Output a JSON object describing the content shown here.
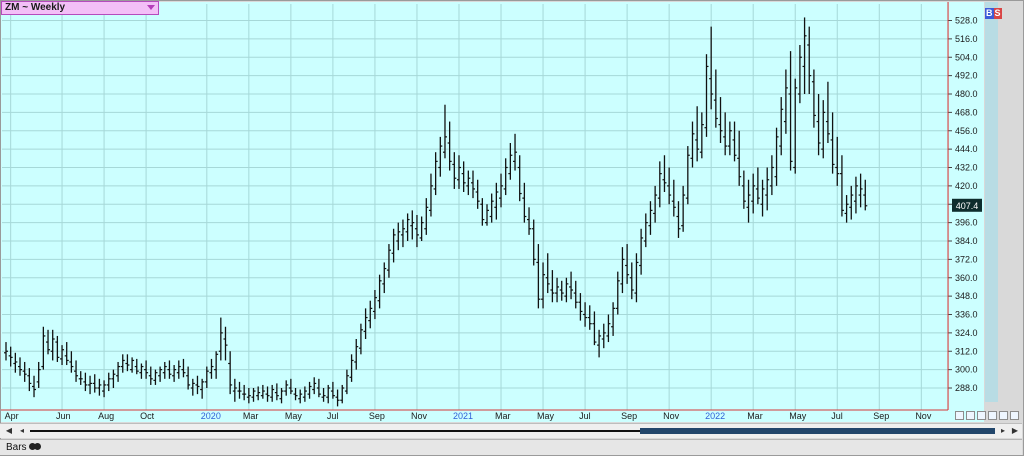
{
  "symbol": {
    "label": "ZM ~ Weekly",
    "dropdown_icon": "triangle-down-icon"
  },
  "rs_badges": [
    {
      "text": "B",
      "color": "#3d5bd9"
    },
    {
      "text": "S",
      "color": "#d94545"
    }
  ],
  "last_price": "407.4",
  "status": {
    "label": "Bars",
    "icon": "glasses-icon"
  },
  "colors": {
    "plot_bg": "#ccffff",
    "grid": "#a6d8d8",
    "bars": "#111111",
    "axis_line": "#d33a3a",
    "year_label": "#2f5fd8",
    "price_tag_bg": "#0e2d2d",
    "right_strip": "#b8dce4"
  },
  "chart_data": {
    "type": "ohlc_bar",
    "title": "ZM ~ Weekly",
    "ylim": [
      276,
      538
    ],
    "y_ticks": [
      288,
      300,
      312,
      324,
      336,
      348,
      360,
      372,
      384,
      396,
      408,
      420,
      432,
      444,
      456,
      468,
      480,
      492,
      504,
      516,
      528
    ],
    "x_ticks": [
      {
        "label": "Apr",
        "week": 1,
        "year": false
      },
      {
        "label": "Jun",
        "week": 12,
        "year": false
      },
      {
        "label": "Aug",
        "week": 21,
        "year": false
      },
      {
        "label": "Oct",
        "week": 30,
        "year": false
      },
      {
        "label": "2020",
        "week": 43,
        "year": true
      },
      {
        "label": "Mar",
        "week": 52,
        "year": false
      },
      {
        "label": "May",
        "week": 61,
        "year": false
      },
      {
        "label": "Jul",
        "week": 70,
        "year": false
      },
      {
        "label": "Sep",
        "week": 79,
        "year": false
      },
      {
        "label": "Nov",
        "week": 88,
        "year": false
      },
      {
        "label": "2021",
        "week": 97,
        "year": true
      },
      {
        "label": "Mar",
        "week": 106,
        "year": false
      },
      {
        "label": "May",
        "week": 115,
        "year": false
      },
      {
        "label": "Jul",
        "week": 124,
        "year": false
      },
      {
        "label": "Sep",
        "week": 133,
        "year": false
      },
      {
        "label": "Nov",
        "week": 142,
        "year": false
      },
      {
        "label": "2022",
        "week": 151,
        "year": true
      },
      {
        "label": "Mar",
        "week": 160,
        "year": false
      },
      {
        "label": "May",
        "week": 169,
        "year": false
      },
      {
        "label": "Jul",
        "week": 178,
        "year": false
      },
      {
        "label": "Sep",
        "week": 187,
        "year": false
      },
      {
        "label": "Nov",
        "week": 196,
        "year": false
      }
    ],
    "bars": [
      [
        311,
        318,
        306,
        312
      ],
      [
        309,
        315,
        302,
        308
      ],
      [
        304,
        311,
        298,
        305
      ],
      [
        302,
        308,
        296,
        300
      ],
      [
        299,
        305,
        292,
        297
      ],
      [
        296,
        301,
        286,
        291
      ],
      [
        289,
        296,
        282,
        287
      ],
      [
        292,
        305,
        288,
        300
      ],
      [
        302,
        328,
        300,
        322
      ],
      [
        318,
        326,
        310,
        313
      ],
      [
        312,
        326,
        306,
        320
      ],
      [
        318,
        322,
        305,
        308
      ],
      [
        307,
        316,
        303,
        313
      ],
      [
        309,
        318,
        303,
        306
      ],
      [
        305,
        312,
        298,
        302
      ],
      [
        299,
        306,
        292,
        296
      ],
      [
        294,
        299,
        290,
        294
      ],
      [
        292,
        298,
        286,
        290
      ],
      [
        290,
        296,
        284,
        291
      ],
      [
        291,
        297,
        285,
        288
      ],
      [
        288,
        294,
        283,
        290
      ],
      [
        286,
        293,
        282,
        290
      ],
      [
        290,
        298,
        286,
        294
      ],
      [
        294,
        300,
        288,
        297
      ],
      [
        296,
        305,
        292,
        302
      ],
      [
        302,
        310,
        298,
        306
      ],
      [
        304,
        310,
        299,
        303
      ],
      [
        300,
        308,
        298,
        306
      ],
      [
        302,
        307,
        297,
        299
      ],
      [
        298,
        304,
        294,
        302
      ],
      [
        300,
        306,
        294,
        298
      ],
      [
        296,
        302,
        290,
        294
      ],
      [
        293,
        300,
        290,
        298
      ],
      [
        296,
        302,
        292,
        300
      ],
      [
        298,
        305,
        294,
        302
      ],
      [
        300,
        306,
        294,
        297
      ],
      [
        296,
        303,
        292,
        300
      ],
      [
        298,
        306,
        294,
        302
      ],
      [
        300,
        307,
        295,
        298
      ],
      [
        296,
        302,
        287,
        290
      ],
      [
        288,
        294,
        283,
        291
      ],
      [
        290,
        296,
        284,
        289
      ],
      [
        287,
        294,
        281,
        292
      ],
      [
        292,
        302,
        288,
        299
      ],
      [
        298,
        307,
        294,
        302
      ],
      [
        300,
        312,
        294,
        310
      ],
      [
        312,
        334,
        306,
        324
      ],
      [
        320,
        328,
        306,
        316
      ],
      [
        304,
        312,
        284,
        290
      ],
      [
        286,
        294,
        279,
        288
      ],
      [
        286,
        292,
        281,
        286
      ],
      [
        284,
        290,
        280,
        284
      ],
      [
        282,
        288,
        278,
        283
      ],
      [
        282,
        288,
        279,
        286
      ],
      [
        283,
        289,
        280,
        285
      ],
      [
        283,
        290,
        281,
        286
      ],
      [
        284,
        289,
        279,
        283
      ],
      [
        282,
        290,
        279,
        287
      ],
      [
        285,
        291,
        280,
        283
      ],
      [
        281,
        288,
        278,
        286
      ],
      [
        286,
        293,
        283,
        290
      ],
      [
        288,
        294,
        284,
        286
      ],
      [
        284,
        288,
        280,
        283
      ],
      [
        281,
        287,
        278,
        284
      ],
      [
        282,
        289,
        279,
        286
      ],
      [
        284,
        292,
        281,
        289
      ],
      [
        287,
        295,
        284,
        291
      ],
      [
        288,
        294,
        282,
        284
      ],
      [
        282,
        288,
        279,
        283
      ],
      [
        282,
        290,
        278,
        288
      ],
      [
        286,
        292,
        281,
        283
      ],
      [
        282,
        287,
        276,
        280
      ],
      [
        280,
        290,
        278,
        288
      ],
      [
        286,
        300,
        284,
        296
      ],
      [
        295,
        310,
        292,
        306
      ],
      [
        305,
        320,
        300,
        315
      ],
      [
        314,
        330,
        310,
        326
      ],
      [
        325,
        340,
        320,
        334
      ],
      [
        332,
        345,
        327,
        340
      ],
      [
        338,
        352,
        333,
        347
      ],
      [
        345,
        362,
        340,
        358
      ],
      [
        356,
        370,
        350,
        366
      ],
      [
        365,
        382,
        360,
        378
      ],
      [
        376,
        392,
        370,
        388
      ],
      [
        384,
        396,
        378,
        390
      ],
      [
        388,
        398,
        380,
        392
      ],
      [
        390,
        402,
        384,
        398
      ],
      [
        394,
        404,
        385,
        396
      ],
      [
        392,
        401,
        380,
        388
      ],
      [
        386,
        400,
        384,
        396
      ],
      [
        392,
        412,
        388,
        406
      ],
      [
        404,
        428,
        400,
        420
      ],
      [
        418,
        442,
        414,
        436
      ],
      [
        432,
        452,
        426,
        446
      ],
      [
        442,
        473,
        438,
        452
      ],
      [
        448,
        462,
        430,
        436
      ],
      [
        434,
        442,
        418,
        425
      ],
      [
        424,
        440,
        418,
        432
      ],
      [
        428,
        436,
        416,
        422
      ],
      [
        420,
        430,
        414,
        425
      ],
      [
        422,
        430,
        412,
        418
      ],
      [
        416,
        424,
        405,
        410
      ],
      [
        408,
        412,
        394,
        398
      ],
      [
        396,
        408,
        394,
        404
      ],
      [
        400,
        415,
        396,
        410
      ],
      [
        406,
        422,
        398,
        416
      ],
      [
        412,
        428,
        406,
        420
      ],
      [
        418,
        438,
        414,
        432
      ],
      [
        428,
        448,
        424,
        440
      ],
      [
        436,
        454,
        430,
        442
      ],
      [
        432,
        440,
        410,
        415
      ],
      [
        412,
        422,
        396,
        400
      ],
      [
        398,
        406,
        388,
        392
      ],
      [
        392,
        398,
        368,
        372
      ],
      [
        370,
        382,
        340,
        346
      ],
      [
        346,
        370,
        340,
        362
      ],
      [
        360,
        376,
        350,
        356
      ],
      [
        352,
        365,
        344,
        350
      ],
      [
        350,
        360,
        344,
        354
      ],
      [
        352,
        358,
        345,
        350
      ],
      [
        348,
        360,
        344,
        356
      ],
      [
        354,
        364,
        346,
        352
      ],
      [
        350,
        358,
        340,
        344
      ],
      [
        344,
        350,
        332,
        338
      ],
      [
        336,
        344,
        328,
        334
      ],
      [
        334,
        342,
        326,
        330
      ],
      [
        330,
        338,
        316,
        318
      ],
      [
        316,
        326,
        308,
        322
      ],
      [
        320,
        330,
        314,
        324
      ],
      [
        322,
        336,
        318,
        330
      ],
      [
        328,
        344,
        322,
        340
      ],
      [
        340,
        364,
        336,
        358
      ],
      [
        356,
        380,
        350,
        372
      ],
      [
        368,
        382,
        356,
        362
      ],
      [
        360,
        370,
        346,
        352
      ],
      [
        350,
        376,
        344,
        370
      ],
      [
        368,
        392,
        362,
        386
      ],
      [
        384,
        402,
        380,
        396
      ],
      [
        394,
        410,
        388,
        404
      ],
      [
        402,
        420,
        396,
        414
      ],
      [
        412,
        436,
        406,
        428
      ],
      [
        424,
        440,
        416,
        422
      ],
      [
        420,
        432,
        408,
        414
      ],
      [
        410,
        424,
        400,
        406
      ],
      [
        400,
        410,
        386,
        392
      ],
      [
        394,
        420,
        390,
        414
      ],
      [
        412,
        446,
        408,
        440
      ],
      [
        438,
        462,
        432,
        454
      ],
      [
        450,
        472,
        436,
        444
      ],
      [
        442,
        468,
        438,
        460
      ],
      [
        458,
        506,
        452,
        498
      ],
      [
        490,
        524,
        470,
        480
      ],
      [
        476,
        496,
        458,
        464
      ],
      [
        460,
        478,
        448,
        456
      ],
      [
        452,
        468,
        440,
        446
      ],
      [
        446,
        462,
        440,
        456
      ],
      [
        450,
        462,
        436,
        440
      ],
      [
        438,
        456,
        420,
        426
      ],
      [
        420,
        430,
        405,
        410
      ],
      [
        406,
        424,
        396,
        414
      ],
      [
        410,
        428,
        402,
        420
      ],
      [
        418,
        432,
        408,
        412
      ],
      [
        408,
        424,
        400,
        418
      ],
      [
        414,
        432,
        404,
        424
      ],
      [
        420,
        440,
        414,
        432
      ],
      [
        426,
        458,
        420,
        452
      ],
      [
        446,
        478,
        440,
        470
      ],
      [
        462,
        496,
        454,
        484
      ],
      [
        480,
        508,
        430,
        436
      ],
      [
        432,
        490,
        428,
        484
      ],
      [
        480,
        512,
        474,
        504
      ],
      [
        498,
        530,
        480,
        518
      ],
      [
        512,
        524,
        480,
        492
      ],
      [
        488,
        496,
        458,
        466
      ],
      [
        462,
        480,
        440,
        448
      ],
      [
        444,
        476,
        438,
        468
      ],
      [
        462,
        488,
        448,
        454
      ],
      [
        450,
        468,
        428,
        434
      ],
      [
        432,
        452,
        420,
        428
      ],
      [
        428,
        440,
        400,
        404
      ],
      [
        402,
        414,
        396,
        408
      ],
      [
        406,
        420,
        398,
        414
      ],
      [
        410,
        426,
        402,
        420
      ],
      [
        414,
        428,
        406,
        418
      ],
      [
        414,
        424,
        404,
        407
      ]
    ]
  }
}
